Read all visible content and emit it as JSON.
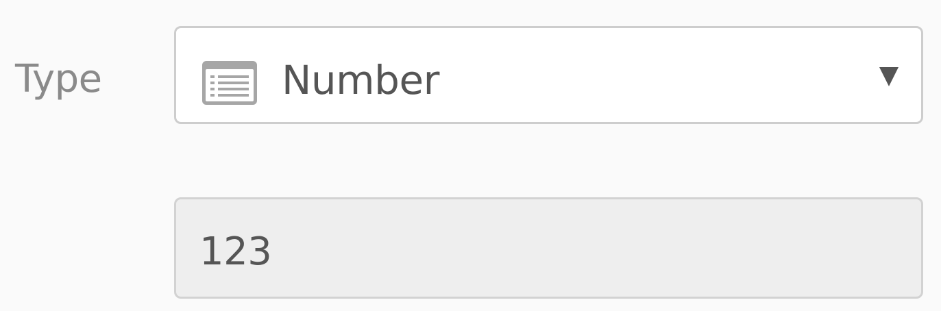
{
  "type_field": {
    "label": "Type",
    "selected_value": "Number",
    "icon": "list-form-icon",
    "dropdown_icon": "triangle-down-icon"
  },
  "value_field": {
    "value": "123",
    "disabled": true
  },
  "colors": {
    "background": "#fafafa",
    "label_text": "#8a8a8a",
    "value_text": "#555555",
    "border": "#cdcdcd",
    "disabled_fill": "#eeeeee",
    "icon": "#a6a6a6",
    "arrow": "#555555"
  }
}
